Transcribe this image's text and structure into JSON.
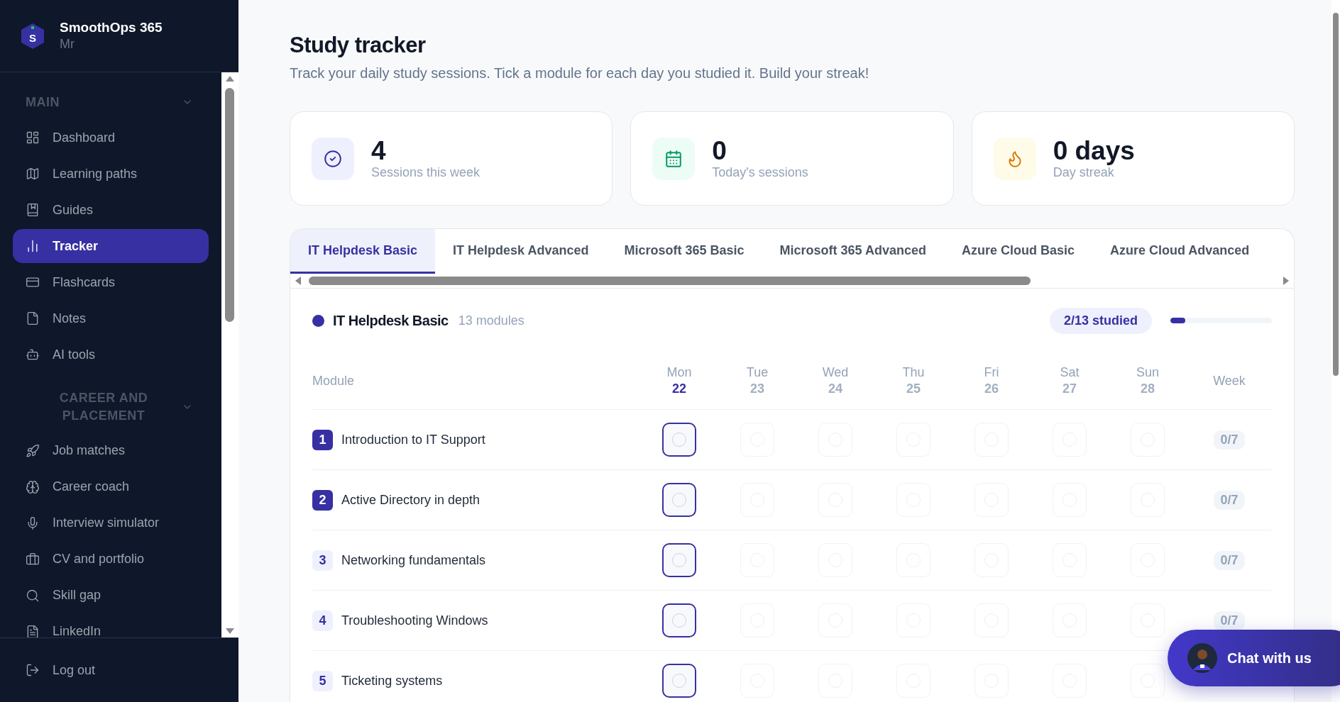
{
  "brand": {
    "name": "SmoothOps 365",
    "subtitle": "Mr",
    "letter": "S"
  },
  "sidebar": {
    "sections": [
      {
        "title": "MAIN",
        "expanded": true,
        "items": [
          {
            "label": "Dashboard",
            "selected": false
          },
          {
            "label": "Learning paths",
            "selected": false
          },
          {
            "label": "Guides",
            "selected": false
          },
          {
            "label": "Tracker",
            "selected": true
          },
          {
            "label": "Flashcards",
            "selected": false
          },
          {
            "label": "Notes",
            "selected": false
          },
          {
            "label": "AI tools",
            "selected": false
          }
        ]
      },
      {
        "title": "CAREER AND PLACEMENT",
        "expanded": true,
        "items": [
          {
            "label": "Job matches",
            "selected": false
          },
          {
            "label": "Career coach",
            "selected": false
          },
          {
            "label": "Interview simulator",
            "selected": false
          },
          {
            "label": "CV and portfolio",
            "selected": false
          },
          {
            "label": "Skill gap",
            "selected": false
          },
          {
            "label": "LinkedIn",
            "selected": false
          }
        ]
      }
    ],
    "logout": "Log out"
  },
  "page": {
    "title": "Study tracker",
    "subtitle": "Track your daily study sessions. Tick a module for each day you studied it. Build your streak!"
  },
  "stats": [
    {
      "value": "4",
      "label": "Sessions this week"
    },
    {
      "value": "0",
      "label": "Today's sessions"
    },
    {
      "value": "0 days",
      "label": "Day streak"
    }
  ],
  "tabs": [
    {
      "label": "IT Helpdesk Basic",
      "selected": true
    },
    {
      "label": "IT Helpdesk Advanced",
      "selected": false
    },
    {
      "label": "Microsoft 365 Basic",
      "selected": false
    },
    {
      "label": "Microsoft 365 Advanced",
      "selected": false
    },
    {
      "label": "Azure Cloud Basic",
      "selected": false
    },
    {
      "label": "Azure Cloud Advanced",
      "selected": false
    }
  ],
  "course": {
    "name": "IT Helpdesk Basic",
    "color": "#3730a3",
    "count": "13 modules",
    "studied": "2/13 studied",
    "level": 0.15
  },
  "columns": {
    "module": "Module",
    "week": "Week",
    "days": [
      {
        "day": "Mon",
        "date": "22",
        "today": true
      },
      {
        "day": "Tue",
        "date": "23",
        "today": false
      },
      {
        "day": "Wed",
        "date": "24",
        "today": false
      },
      {
        "day": "Thu",
        "date": "25",
        "today": false
      },
      {
        "day": "Fri",
        "date": "26",
        "today": false
      },
      {
        "day": "Sat",
        "date": "27",
        "today": false
      },
      {
        "day": "Sun",
        "date": "28",
        "today": false
      }
    ]
  },
  "rows": [
    {
      "number": "1",
      "name": "Introduction to IT Support",
      "studied": true,
      "checks": [
        false,
        false,
        false,
        false,
        false,
        false,
        false
      ],
      "week": "0/7"
    },
    {
      "number": "2",
      "name": "Active Directory in depth",
      "studied": true,
      "checks": [
        false,
        false,
        false,
        false,
        false,
        false,
        false
      ],
      "week": "0/7"
    },
    {
      "number": "3",
      "name": "Networking fundamentals",
      "studied": false,
      "checks": [
        false,
        false,
        false,
        false,
        false,
        false,
        false
      ],
      "week": "0/7"
    },
    {
      "number": "4",
      "name": "Troubleshooting Windows",
      "studied": false,
      "checks": [
        false,
        false,
        false,
        false,
        false,
        false,
        false
      ],
      "week": "0/7"
    },
    {
      "number": "5",
      "name": "Ticketing systems",
      "studied": false,
      "checks": [
        false,
        false,
        false,
        false,
        false,
        false,
        false
      ]
    }
  ],
  "chat": {
    "label": "Chat with us"
  }
}
